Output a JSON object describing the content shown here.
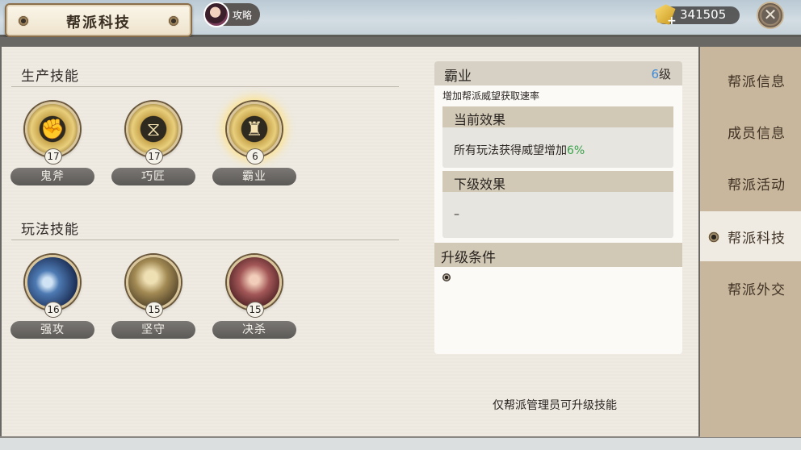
{
  "header": {
    "title": "帮派科技",
    "strategy_label": "攻略",
    "currency_value": "341505"
  },
  "sections": {
    "production": {
      "title": "生产技能",
      "skills": [
        {
          "name": "鬼斧",
          "level": "17",
          "glyph": "✊"
        },
        {
          "name": "巧匠",
          "level": "17",
          "glyph": "⧖"
        },
        {
          "name": "霸业",
          "level": "6",
          "glyph": "♜"
        }
      ]
    },
    "gameplay": {
      "title": "玩法技能",
      "skills": [
        {
          "name": "强攻",
          "level": "16"
        },
        {
          "name": "坚守",
          "level": "15"
        },
        {
          "name": "决杀",
          "level": "15"
        }
      ]
    }
  },
  "detail": {
    "skill_name": "霸业",
    "level_num": "6",
    "level_unit": "级",
    "description": "增加帮派威望获取速率",
    "current_effect_title": "当前效果",
    "current_effect_text": "所有玩法获得威望增加",
    "current_effect_value": "6%",
    "next_effect_title": "下级效果",
    "next_effect_text": "–",
    "upgrade_title": "升级条件"
  },
  "admin_note": "仅帮派管理员可升级技能",
  "tabs": [
    {
      "label": "帮派信息"
    },
    {
      "label": "成员信息"
    },
    {
      "label": "帮派活动"
    },
    {
      "label": "帮派科技"
    },
    {
      "label": "帮派外交"
    }
  ],
  "icons": {
    "close": "close-icon",
    "currency": "gold-ingot-icon"
  },
  "colors": {
    "level_blue": "#3d8ad8",
    "effect_green": "#39a24a"
  }
}
